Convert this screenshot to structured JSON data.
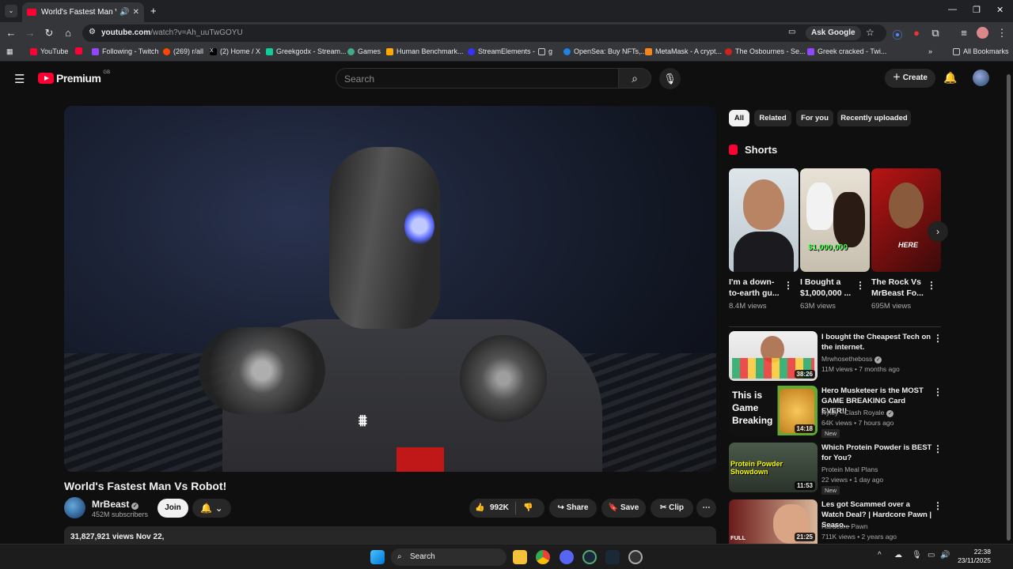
{
  "browser": {
    "tab_title": "World's Fastest Man Vs Robot!",
    "url_host": "youtube.com",
    "url_path": "/watch?v=Ah_uuTwGOYU",
    "ask_google": "Ask Google",
    "bookmarks": [
      "YouTube",
      "Following - Twitch",
      "(269) r/all",
      "(2) Home / X",
      "Greekgodx - Stream...",
      "Games",
      "Human Benchmark...",
      "StreamElements -",
      "g",
      "OpenSea: Buy NFTs,...",
      "MetaMask - A crypt...",
      "The Osbournes - Se...",
      "Greek cracked - Twi..."
    ],
    "all_bookmarks": "All Bookmarks"
  },
  "yt": {
    "logo_text": "Premium",
    "region": "GB",
    "search_placeholder": "Search",
    "create_label": "Create"
  },
  "video": {
    "title": "World's Fastest Man Vs Robot!",
    "channel": "MrBeast",
    "subscribers": "452M subscribers",
    "join_label": "Join",
    "likes": "992K",
    "share_label": "Share",
    "save_label": "Save",
    "clip_label": "Clip",
    "views_date": "31,827,921 views  Nov 22,"
  },
  "sidebar": {
    "chips": [
      "All",
      "Related",
      "For you",
      "Recently uploaded"
    ],
    "shorts_heading": "Shorts",
    "shorts": [
      {
        "title": "I'm a down-to-earth gu...",
        "views": "8.4M views"
      },
      {
        "title": "I Bought a $1,000,000 ...",
        "views": "63M views"
      },
      {
        "title": "The Rock Vs MrBeast Fo...",
        "views": "695M views"
      }
    ],
    "short_overlay_2": "$1,000,000",
    "short_overlay_3": "HERE",
    "videos": [
      {
        "title": "I bought the Cheapest Tech on the internet.",
        "channel": "Mrwhosetheboss",
        "meta": "11M views • 7 months ago",
        "duration": "38:26",
        "new": ""
      },
      {
        "title": "Hero Musketeer is the MOST GAME BREAKING Card EVER!!",
        "channel": "Ryley - Clash Royale",
        "meta": "64K views • 7 hours ago",
        "duration": "14:18",
        "new": "New",
        "thumb_text": "This is Game Breaking"
      },
      {
        "title": "Which Protein Powder is BEST for You?",
        "channel": "Protein Meal Plans",
        "meta": "22 views • 1 day ago",
        "duration": "11:53",
        "new": "New",
        "thumb_text": "Protein Powder Showdown"
      },
      {
        "title": "Les got Scammed over a Watch Deal? | Hardcore Pawn | Seaso...",
        "channel": "Hardcore Pawn",
        "meta": "711K views • 2 years ago",
        "duration": "21:25",
        "new": "",
        "thumb_text": "FULL"
      }
    ]
  },
  "taskbar": {
    "search_label": "Search",
    "time": "22:38",
    "date": "23/11/2025"
  },
  "colors": {
    "accent": "#ff0033",
    "bg": "#0f0f0f"
  }
}
